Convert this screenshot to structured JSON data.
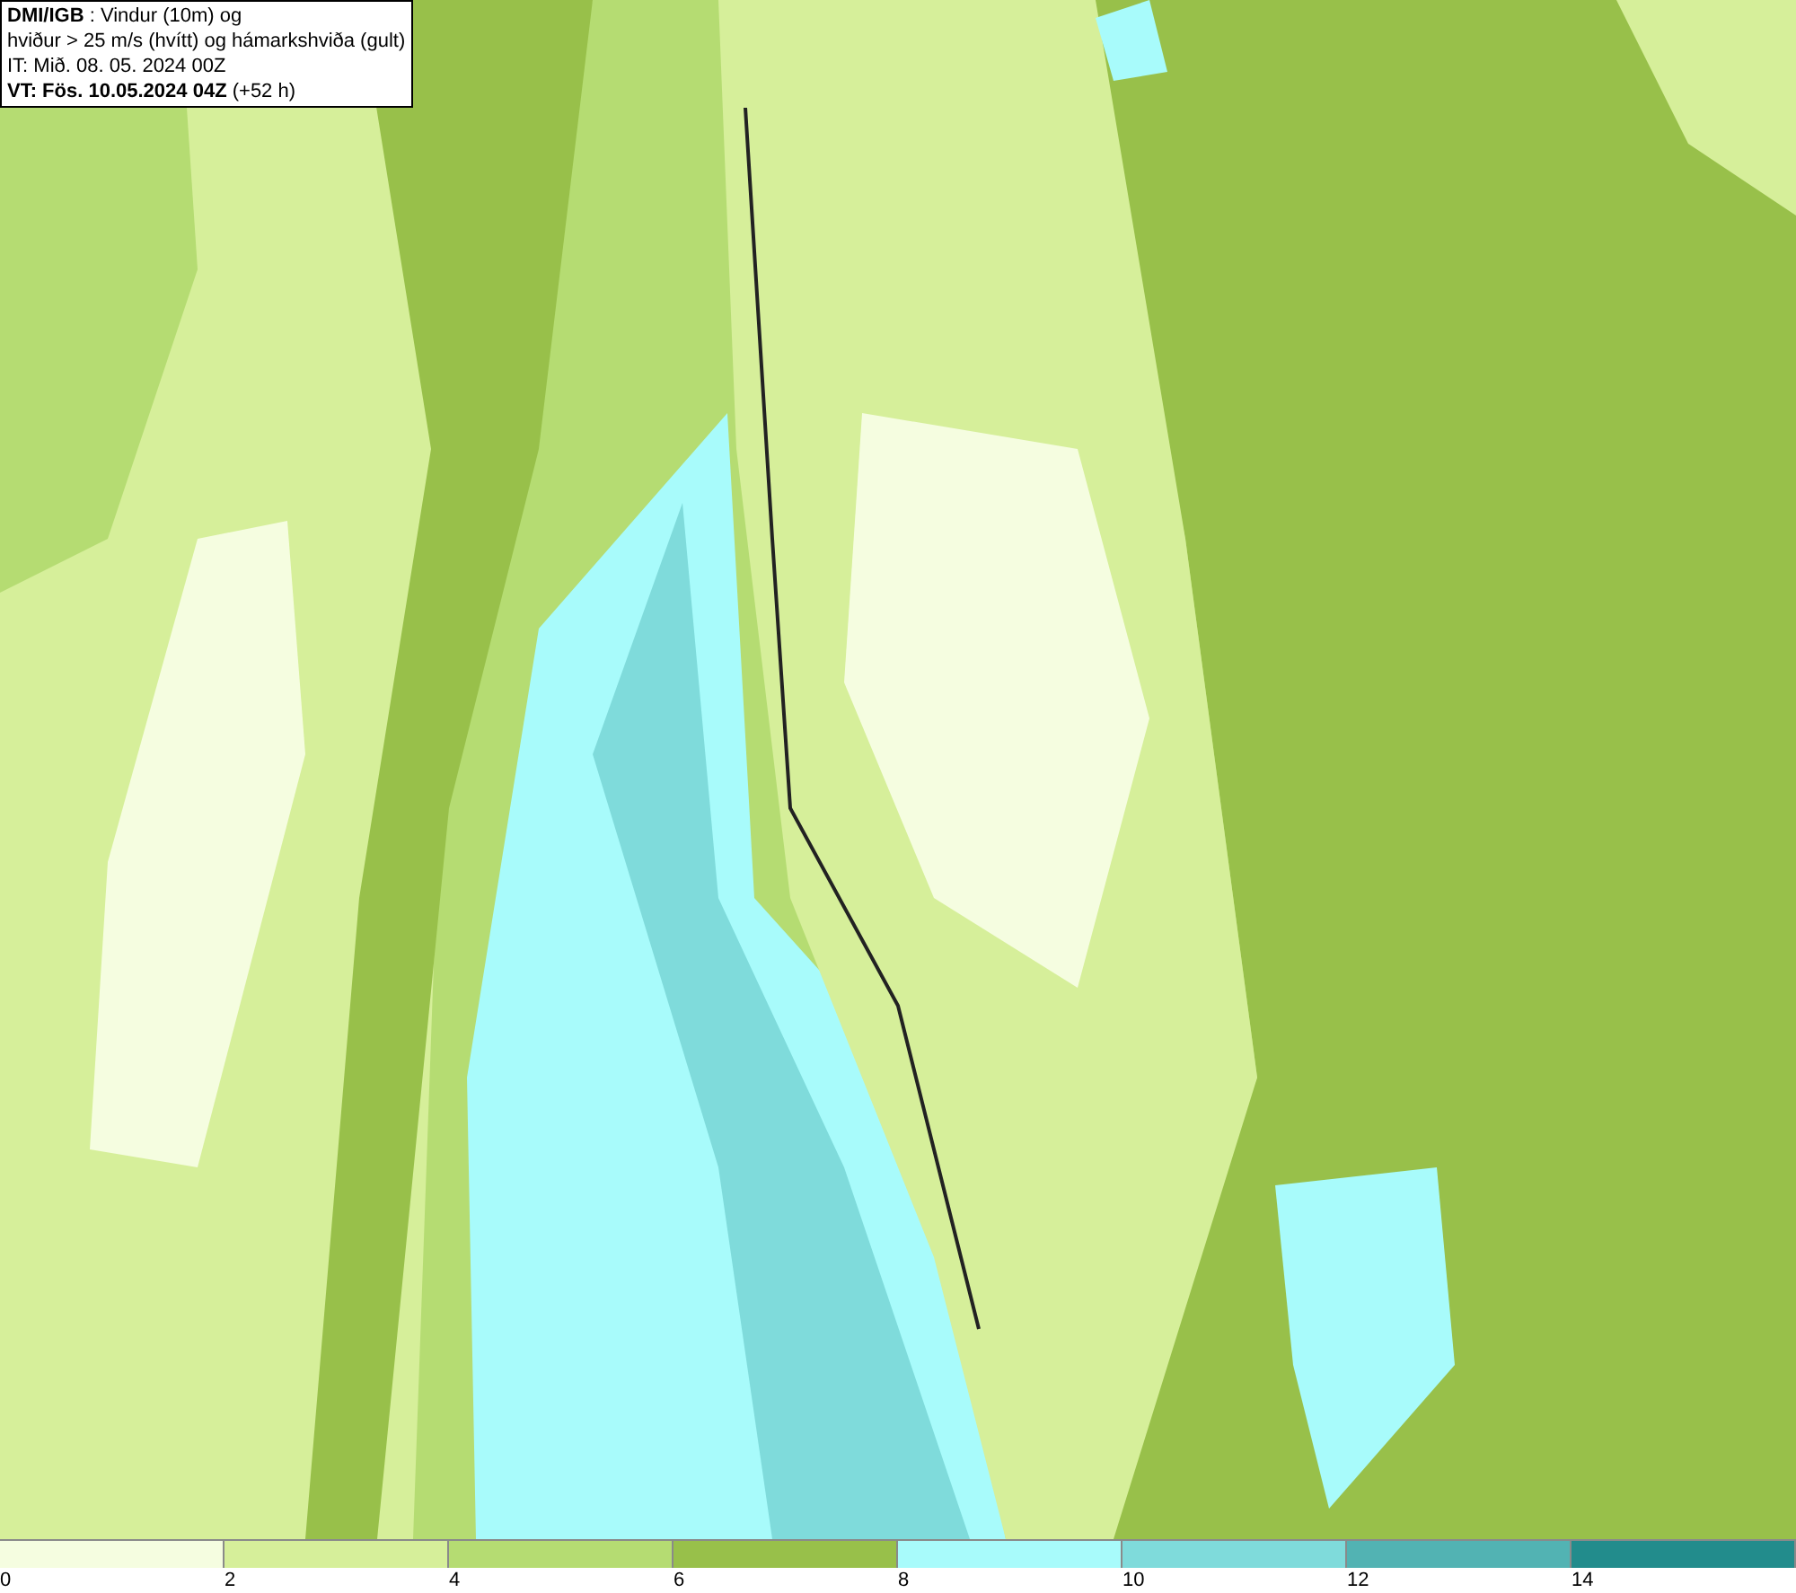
{
  "title_box": {
    "lines": [
      "**DMI/IGB** : Vindur (10m) og",
      "hviður > 25 m/s (hvítt) og hámarkshviða (gult)",
      "IT: Mið. 08. 05. 2024 00Z",
      "**VT: Fös. 10.05.2024 04Z** (+52 h)"
    ]
  },
  "legend": [
    {
      "label": "0",
      "color": "#f5fde0"
    },
    {
      "label": "2",
      "color": "#d6ef9a"
    },
    {
      "label": "4",
      "color": "#b5dc72"
    },
    {
      "label": "6",
      "color": "#98c04a"
    },
    {
      "label": "8",
      "color": "#a8fbfb"
    },
    {
      "label": "10",
      "color": "#7fdbdb"
    },
    {
      "label": "12",
      "color": "#52b3b3"
    },
    {
      "label": "14",
      "color": "#228c8c"
    }
  ]
}
